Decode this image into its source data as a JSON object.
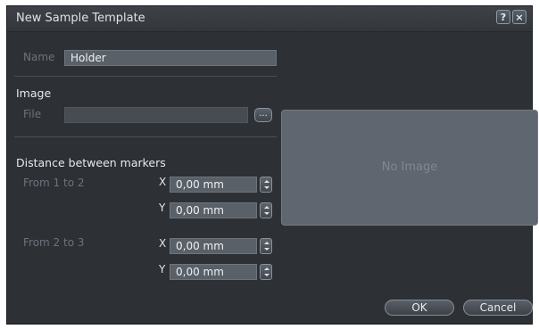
{
  "dialog": {
    "title": "New Sample Template",
    "help_label": "?",
    "close_label": "×"
  },
  "name_row": {
    "label": "Name",
    "value": "Holder"
  },
  "image_section": {
    "heading": "Image",
    "file_label": "File",
    "file_value": "",
    "browse_label": "...",
    "preview_text": "No Image"
  },
  "distance_section": {
    "heading": "Distance between markers",
    "groups": [
      {
        "label": "From 1 to 2",
        "x_label": "X",
        "x_value": "0,00 mm",
        "y_label": "Y",
        "y_value": "0,00 mm"
      },
      {
        "label": "From 2 to 3",
        "x_label": "X",
        "x_value": "0,00 mm",
        "y_label": "Y",
        "y_value": "0,00 mm"
      }
    ]
  },
  "buttons": {
    "ok_label": "OK",
    "cancel_label": "Cancel"
  }
}
